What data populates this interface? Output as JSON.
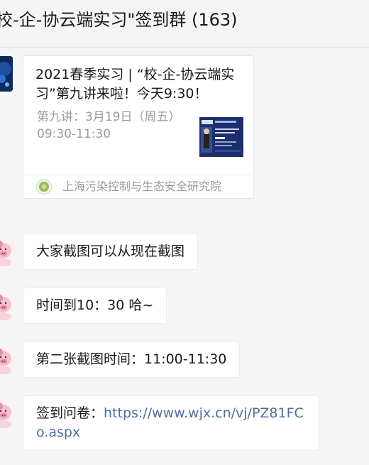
{
  "header": {
    "title": "校-企-协云端实习\"签到群 (163)"
  },
  "card": {
    "title": "2021春季实习 | “校-企-协云端实习”第九讲来啦！今天9:30！",
    "description": "第九讲：3月19日（周五）09:30-11:30",
    "source": "上海污染控制与生态安全研究院"
  },
  "messages": [
    {
      "text": "大家截图可以从现在截图"
    },
    {
      "text": "时间到10：30 哈~"
    },
    {
      "text": "第二张截图时间：11:00-11:30"
    },
    {
      "prefix": "签到问卷：",
      "link": "https://www.wjx.cn/vj/PZ81FCo.aspx"
    }
  ],
  "colors": {
    "background": "#f5f5f5",
    "bubble": "#ffffff",
    "link": "#4f6da0",
    "muted": "#9a9a9a"
  }
}
